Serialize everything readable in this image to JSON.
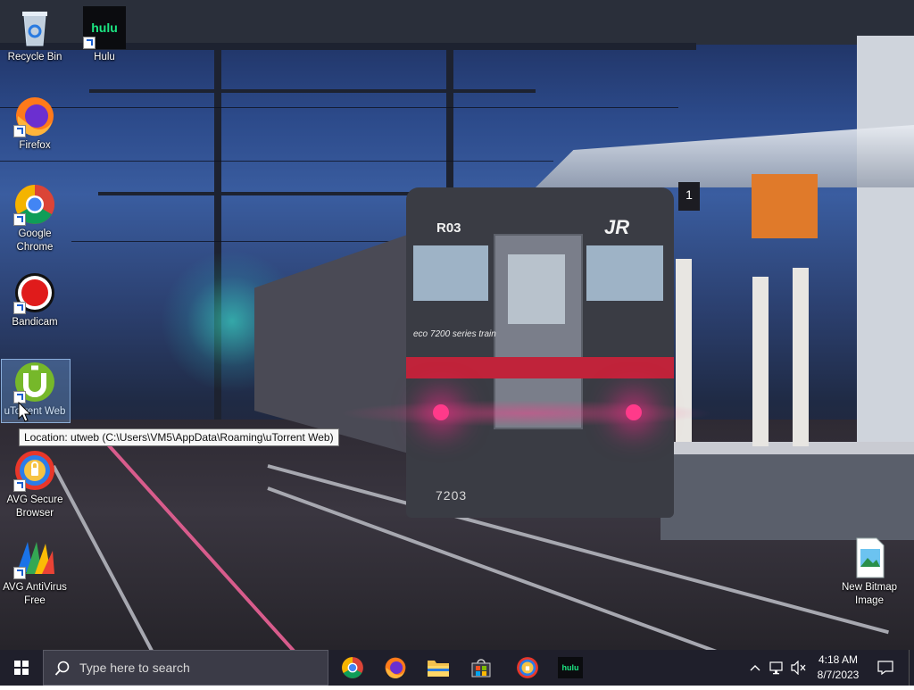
{
  "desktop": {
    "icons": [
      {
        "label": "Recycle Bin",
        "name": "recycle-bin-icon"
      },
      {
        "label": "Hulu",
        "name": "hulu-icon"
      },
      {
        "label": "Firefox",
        "name": "firefox-icon"
      },
      {
        "label": "Google Chrome",
        "name": "chrome-icon"
      },
      {
        "label": "Bandicam",
        "name": "bandicam-icon"
      },
      {
        "label": "uTorrent Web",
        "name": "utorrent-icon"
      },
      {
        "label": "AVG Secure Browser",
        "name": "avg-secure-browser-icon"
      },
      {
        "label": "AVG AntiVirus Free",
        "name": "avg-antivirus-icon"
      },
      {
        "label": "New Bitmap Image",
        "name": "bitmap-file-icon"
      }
    ],
    "tooltip": "Location: utweb (C:\\Users\\VM5\\AppData\\Roaming\\uTorrent Web)",
    "wallpaper": {
      "train_code": "R03",
      "train_brand": "JR",
      "train_series": "eco 7200 series train",
      "train_number": "7203",
      "platform_sign": "1"
    }
  },
  "taskbar": {
    "search_placeholder": "Type here to search",
    "hulu_label": "hulu",
    "time": "4:18 AM",
    "date": "8/7/2023"
  },
  "colors": {
    "taskbar_bg": "#1f1f2b",
    "accent_blue": "#0078d7",
    "hulu_green": "#1ce783"
  }
}
